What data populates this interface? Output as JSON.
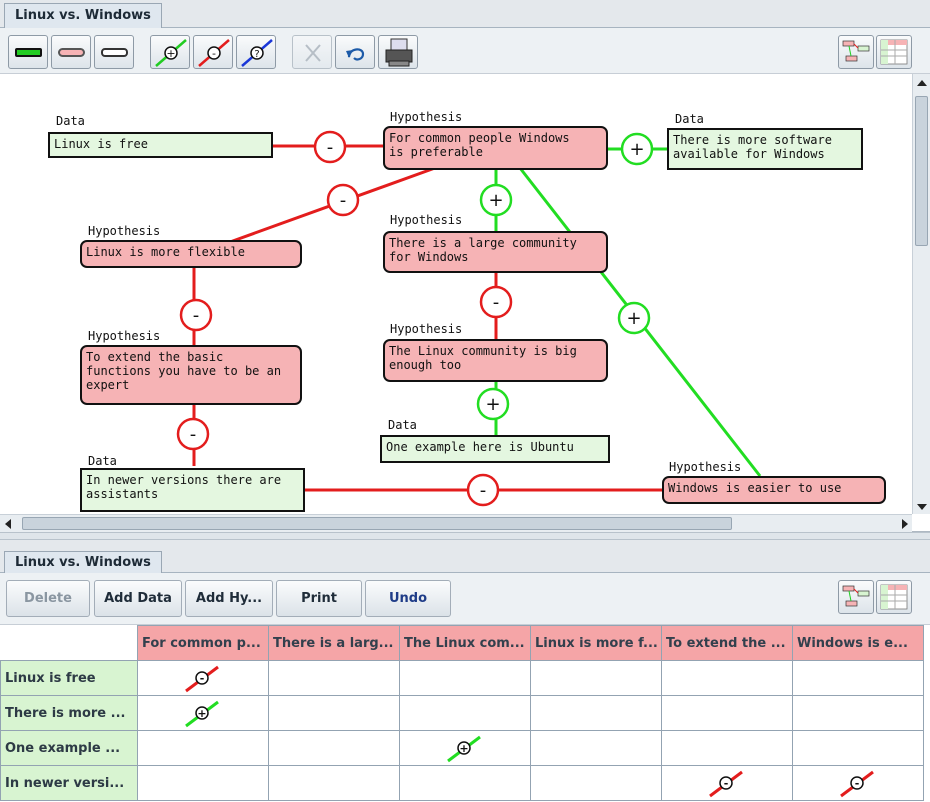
{
  "top_tab": "Linux vs. Windows",
  "bottom_tab": "Linux vs. Windows",
  "toolbar_icons": [
    "data-node-icon",
    "hypothesis-node-icon",
    "comment-node-icon",
    "pro-link-icon",
    "contra-link-icon",
    "question-link-icon",
    "delete-icon",
    "undo-icon",
    "print-icon",
    "graph-view-icon",
    "matrix-view-icon"
  ],
  "graph": {
    "nodes": [
      {
        "id": "n1",
        "type": "Data",
        "text": "Linux is free"
      },
      {
        "id": "n2",
        "type": "Hypothesis",
        "text": "For common people Windows\nis preferable"
      },
      {
        "id": "n3",
        "type": "Data",
        "text": "There is more software\navailable for Windows"
      },
      {
        "id": "n4",
        "type": "Hypothesis",
        "text": "Linux is more flexible"
      },
      {
        "id": "n5",
        "type": "Hypothesis",
        "text": "There is a large community\nfor Windows"
      },
      {
        "id": "n6",
        "type": "Hypothesis",
        "text": "To extend the basic\nfunctions you have to be an\nexpert"
      },
      {
        "id": "n7",
        "type": "Hypothesis",
        "text": "The Linux community is big\nenough too"
      },
      {
        "id": "n8",
        "type": "Data",
        "text": "One example here is Ubuntu"
      },
      {
        "id": "n9",
        "type": "Data",
        "text": "In newer versions there are\nassistants"
      },
      {
        "id": "n10",
        "type": "Hypothesis",
        "text": "Windows is easier to use"
      }
    ],
    "links": [
      {
        "from": "n1",
        "to": "n2",
        "sign": "-"
      },
      {
        "from": "n3",
        "to": "n2",
        "sign": "+"
      },
      {
        "from": "n4",
        "to": "n2",
        "sign": "-"
      },
      {
        "from": "n5",
        "to": "n2",
        "sign": "+"
      },
      {
        "from": "n10",
        "to": "n2",
        "sign": "+"
      },
      {
        "from": "n6",
        "to": "n4",
        "sign": "-"
      },
      {
        "from": "n7",
        "to": "n5",
        "sign": "-"
      },
      {
        "from": "n8",
        "to": "n7",
        "sign": "+"
      },
      {
        "from": "n9",
        "to": "n6",
        "sign": "-"
      },
      {
        "from": "n9",
        "to": "n10",
        "sign": "-"
      }
    ]
  },
  "buttons": {
    "delete": "Delete",
    "add_data": "Add Data",
    "add_hyp": "Add Hy...",
    "print": "Print",
    "undo": "Undo"
  },
  "matrix": {
    "columns": [
      "For common p...",
      "There is a larg...",
      "The Linux com...",
      "Linux is more f...",
      "To extend the ...",
      "Windows is e..."
    ],
    "rows": [
      {
        "label": "Linux is free",
        "cells": [
          "-",
          "",
          "",
          "",
          "",
          ""
        ]
      },
      {
        "label": "There is more ...",
        "cells": [
          "+",
          "",
          "",
          "",
          "",
          ""
        ]
      },
      {
        "label": "One example ...",
        "cells": [
          "",
          "",
          "+",
          "",
          "",
          ""
        ]
      },
      {
        "label": "In newer versi...",
        "cells": [
          "",
          "",
          "",
          "",
          "-",
          "-"
        ]
      }
    ]
  },
  "colors": {
    "pro": "#22dd22",
    "contra": "#e31d1d",
    "data_fill": "#e4f7e0",
    "hyp_fill": "#f6b3b5",
    "col_header": "#f5a5a7",
    "row_header": "#d8f4d1"
  }
}
